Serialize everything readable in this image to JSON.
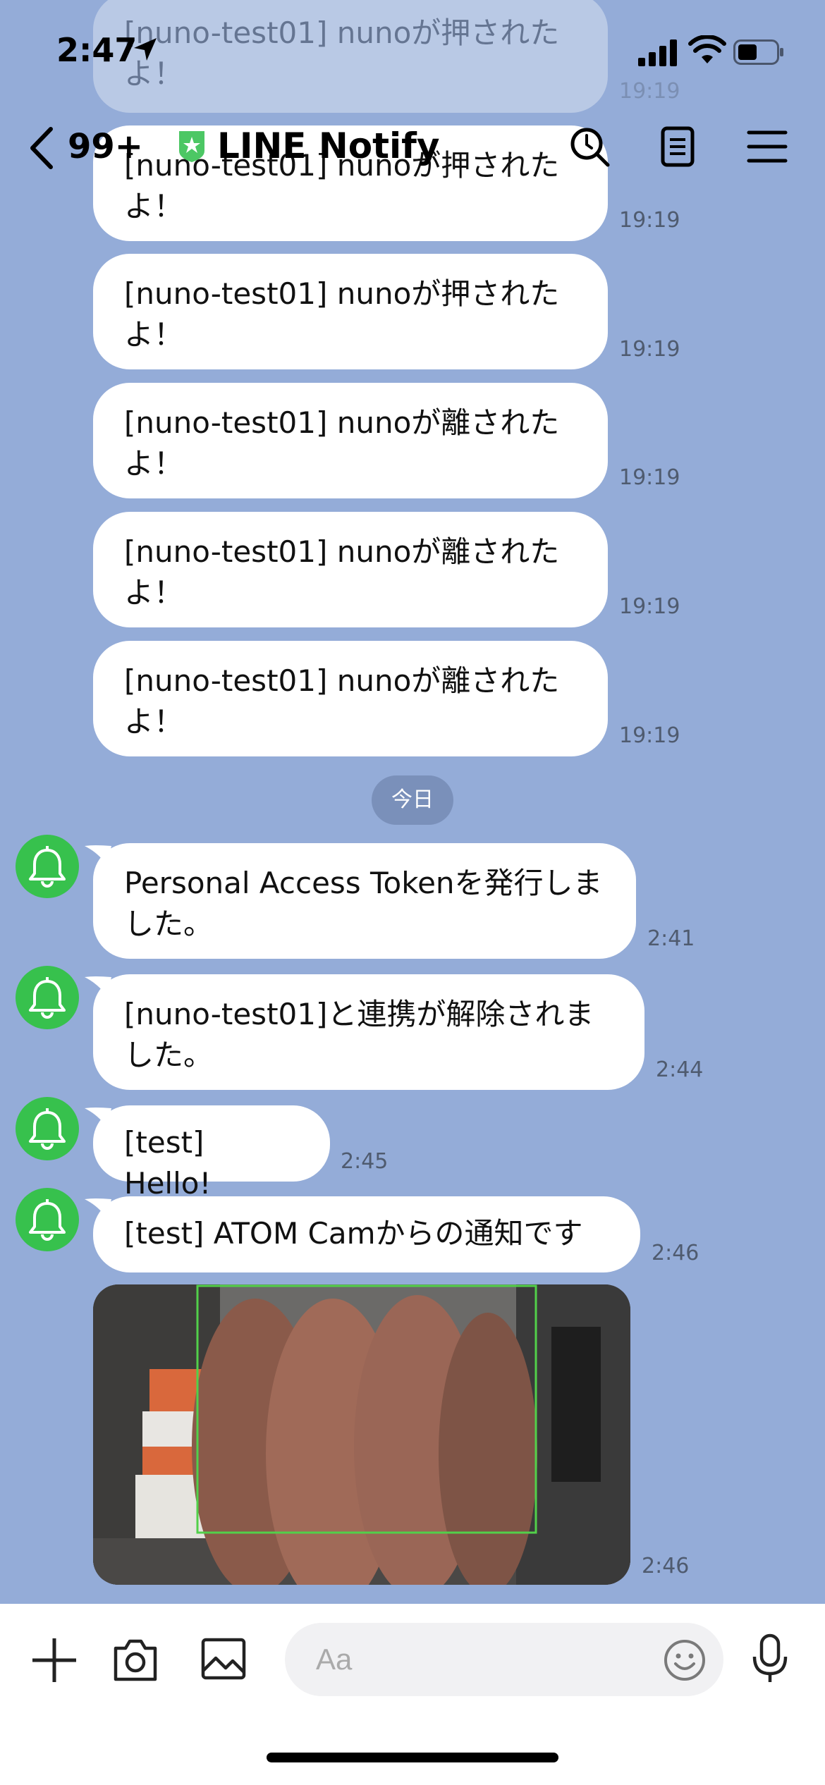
{
  "status_bar": {
    "time": "2:47"
  },
  "header": {
    "back_count": "99+",
    "title": "LINE Notify"
  },
  "messages": {
    "ghost1": {
      "text": "[nuno-test01] nunoが押されたよ！",
      "time": "19:19"
    },
    "ghost2": {
      "text": "[nuno-test01] nunoが押されたよ！",
      "time": "19:19"
    },
    "m1": {
      "text": "[nuno-test01] nunoが押されたよ！",
      "time": "19:19"
    },
    "m2": {
      "text": "[nuno-test01] nunoが離されたよ！",
      "time": "19:19"
    },
    "m3": {
      "text": "[nuno-test01] nunoが離されたよ！",
      "time": "19:19"
    },
    "m4": {
      "text": "[nuno-test01] nunoが離されたよ！",
      "time": "19:19"
    },
    "date_separator": "今日",
    "n1": {
      "text": "Personal Access Tokenを発行しました。",
      "time": "2:41"
    },
    "n2": {
      "text": "[nuno-test01]と連携が解除されました。",
      "time": "2:44"
    },
    "n3": {
      "text": "[test] Hello!",
      "time": "2:45"
    },
    "n4": {
      "text": "[test] ATOM Camからの通知です",
      "time": "2:46"
    },
    "n5": {
      "time": "2:46"
    }
  },
  "input_bar": {
    "placeholder": "Aa"
  },
  "colors": {
    "background": "#94acd8",
    "avatar": "#37c14d",
    "bubble": "#ffffff"
  },
  "icons": [
    "location-arrow-icon",
    "signal-icon",
    "wifi-icon",
    "battery-icon",
    "back-chevron-icon",
    "line-official-shield-icon",
    "search-icon",
    "notes-icon",
    "menu-icon",
    "bell-icon",
    "plus-icon",
    "camera-icon",
    "image-icon",
    "emoji-icon",
    "microphone-icon"
  ]
}
